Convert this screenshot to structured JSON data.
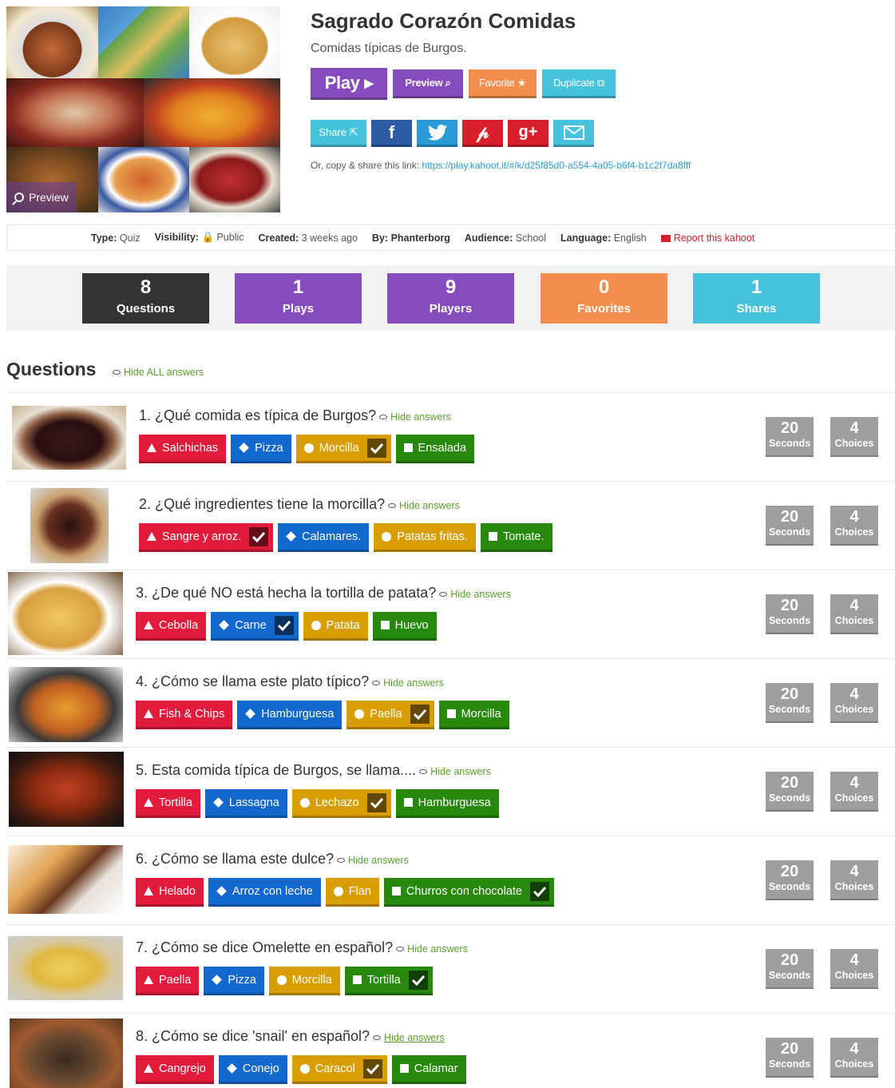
{
  "kahoot": {
    "title": "Sagrado Corazón Comidas",
    "description": "Comidas típicas de Burgos.",
    "cover_preview_label": "Preview"
  },
  "actions": {
    "play": "Play ▸",
    "preview": "Preview ⌕",
    "favorite": "Favorite ★",
    "duplicate": "Duplicate ⧉"
  },
  "share": {
    "share_label": "Share ⇱",
    "copy_prefix": "Or, copy & share this link:",
    "link": "https://play.kahoot.it/#/k/d25f85d0-a554-4a05-b6f4-b1c2f7da8fff"
  },
  "meta": {
    "type_label": "Type:",
    "type": "Quiz",
    "visibility_label": "Visibility:",
    "visibility": "🔒 Public",
    "created_label": "Created:",
    "created": "3 weeks ago",
    "by_label": "By:",
    "by": "Phanterborg",
    "audience_label": "Audience:",
    "audience": "School",
    "language_label": "Language:",
    "language": "English",
    "report": "Report this kahoot"
  },
  "stats": [
    {
      "value": "8",
      "label": "Questions",
      "color": "#333333"
    },
    {
      "value": "1",
      "label": "Plays",
      "color": "#864cbf"
    },
    {
      "value": "9",
      "label": "Players",
      "color": "#864cbf"
    },
    {
      "value": "0",
      "label": "Favorites",
      "color": "#f58d4d"
    },
    {
      "value": "1",
      "label": "Shares",
      "color": "#46c2dc"
    }
  ],
  "questions_heading": "Questions",
  "hide_all": "Hide ALL answers",
  "hide_answers": "Hide answers",
  "questions": [
    {
      "text": "1. ¿Qué comida es típica de Burgos?",
      "time": "20",
      "time_label": "Seconds",
      "choices_count": "4",
      "choices_label": "Choices",
      "answers": [
        "Salchichas",
        "Pizza",
        "Morcilla",
        "Ensalada"
      ],
      "correct": 2
    },
    {
      "text": "2. ¿Qué ingredientes tiene la morcilla?",
      "time": "20",
      "time_label": "Seconds",
      "choices_count": "4",
      "choices_label": "Choices",
      "answers": [
        "Sangre y arroz.",
        "Calamares.",
        "Patatas fritas.",
        "Tomate."
      ],
      "correct": 0
    },
    {
      "text": "3. ¿De qué NO está hecha la tortilla de patata?",
      "time": "20",
      "time_label": "Seconds",
      "choices_count": "4",
      "choices_label": "Choices",
      "answers": [
        "Cebolla",
        "Carne",
        "Patata",
        "Huevo"
      ],
      "correct": 1
    },
    {
      "text": "4. ¿Cómo se llama este plato típico?",
      "time": "20",
      "time_label": "Seconds",
      "choices_count": "4",
      "choices_label": "Choices",
      "answers": [
        "Fish & Chips",
        "Hamburguesa",
        "Paella",
        "Morcilla"
      ],
      "correct": 2
    },
    {
      "text": "5. Esta comida típica de Burgos, se llama....",
      "time": "20",
      "time_label": "Seconds",
      "choices_count": "4",
      "choices_label": "Choices",
      "answers": [
        "Tortilla",
        "Lassagna",
        "Lechazo",
        "Hamburguesa"
      ],
      "correct": 2
    },
    {
      "text": "6. ¿Cómo se llama este dulce?",
      "time": "20",
      "time_label": "Seconds",
      "choices_count": "4",
      "choices_label": "Choices",
      "answers": [
        "Helado",
        "Arroz con leche",
        "Flan",
        "Churros con chocolate"
      ],
      "correct": 3
    },
    {
      "text": "7. ¿Cómo se dice Omelette en español?",
      "time": "20",
      "time_label": "Seconds",
      "choices_count": "4",
      "choices_label": "Choices",
      "answers": [
        "Paella",
        "Pizza",
        "Morcilla",
        "Tortilla"
      ],
      "correct": 3
    },
    {
      "text": "8. ¿Cómo se dice 'snail' en español?",
      "time": "20",
      "time_label": "Seconds",
      "choices_count": "4",
      "choices_label": "Choices",
      "answers": [
        "Cangrejo",
        "Conejo",
        "Caracol",
        "Calamar"
      ],
      "correct": 2
    }
  ],
  "icons": {
    "play": "play-icon",
    "preview": "magnifier-icon",
    "favorite": "star-icon",
    "duplicate": "duplicate-icon",
    "facebook": "facebook-icon",
    "twitter": "twitter-icon",
    "pinterest": "pinterest-icon",
    "googleplus": "googleplus-icon",
    "email": "envelope-icon",
    "report": "flag-icon",
    "hide": "eye-icon",
    "answer_shapes": [
      "triangle-icon",
      "diamond-icon",
      "circle-icon",
      "square-icon"
    ],
    "correct": "checkmark-icon"
  },
  "colors": {
    "red": "#e21b3c",
    "blue": "#1368ce",
    "yellow": "#d89e00",
    "green": "#26890c",
    "purple": "#864cbf",
    "orange": "#f58d4d",
    "cyan": "#46c2dc",
    "badge": "#9e9e9e"
  }
}
